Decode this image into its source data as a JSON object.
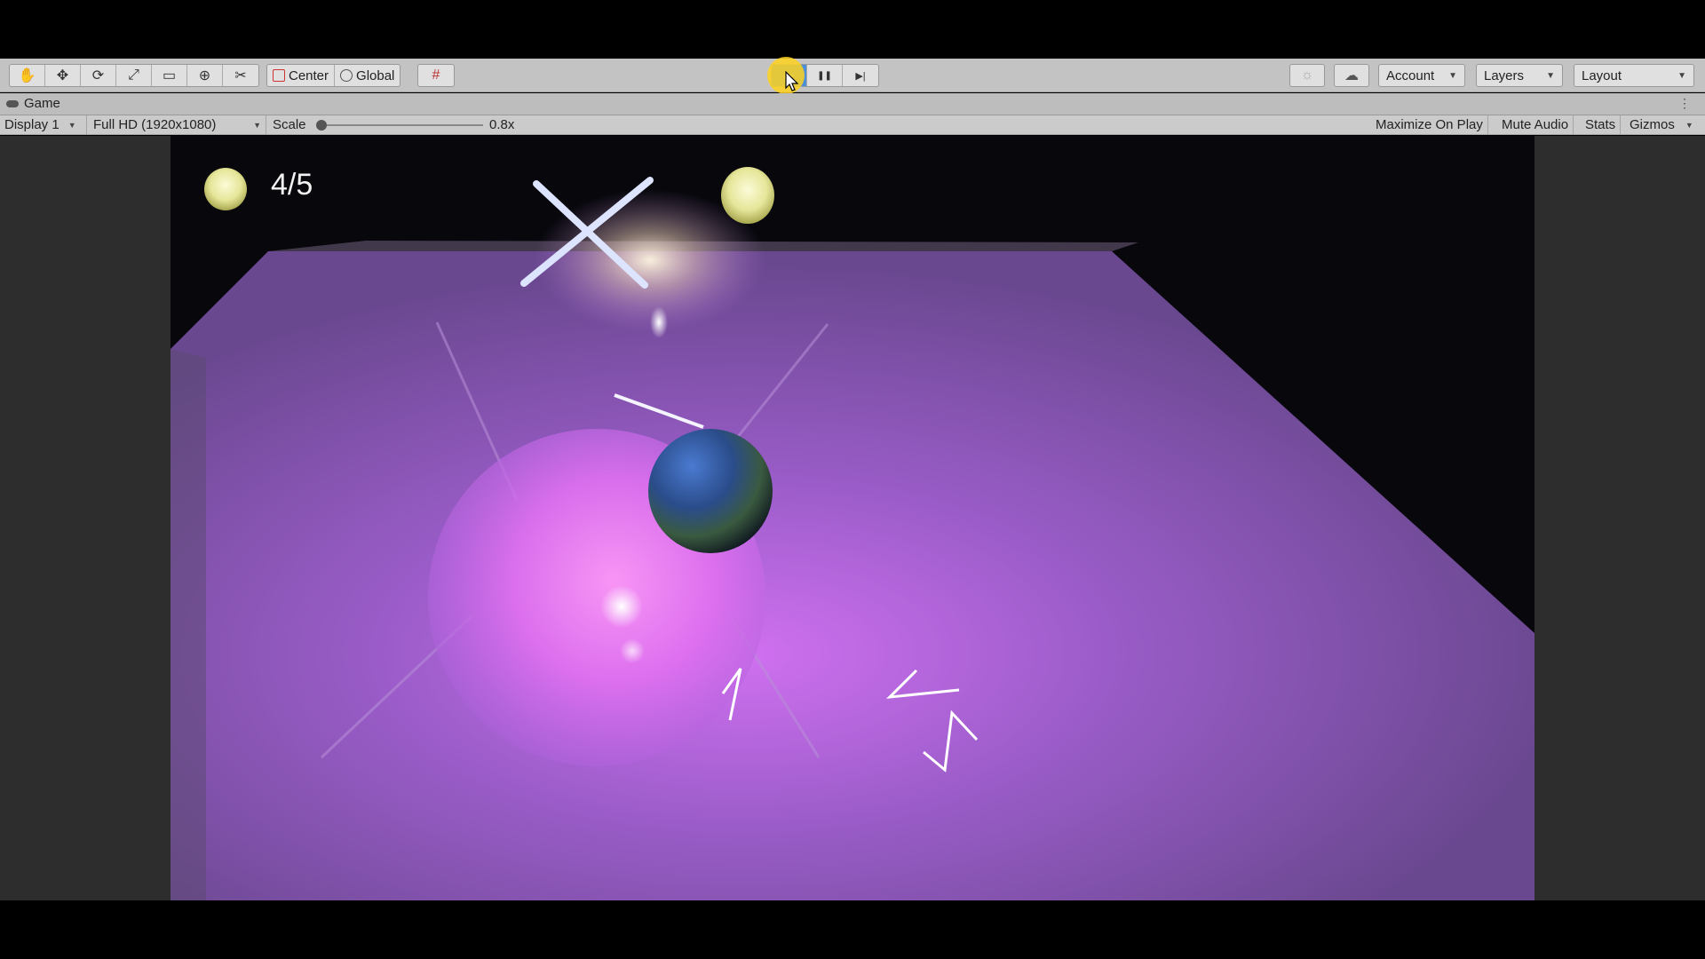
{
  "toolbar": {
    "tools": [
      {
        "name": "hand-tool",
        "icon": "hand-icon",
        "glyph": "✋"
      },
      {
        "name": "move-tool",
        "icon": "move-icon",
        "glyph": "✥"
      },
      {
        "name": "rotate-tool",
        "icon": "rotate-icon",
        "glyph": "⟳"
      },
      {
        "name": "scale-tool",
        "icon": "scale-icon",
        "glyph": "⤢"
      },
      {
        "name": "rect-tool",
        "icon": "rect-icon",
        "glyph": "▭"
      },
      {
        "name": "transform-tool",
        "icon": "transform-icon",
        "glyph": "⊕"
      },
      {
        "name": "custom-tool",
        "icon": "tools-icon",
        "glyph": "✂"
      }
    ],
    "pivot_mode": "Center",
    "pivot_rotation": "Global",
    "grid_snap_glyph": "#",
    "play": {
      "play_glyph": "▶",
      "pause_glyph": "❚❚",
      "step_glyph": "▶|"
    },
    "cloud_glyph": "☁",
    "collab_glyph": "☼",
    "account_label": "Account",
    "layers_label": "Layers",
    "layout_label": "Layout"
  },
  "tab": {
    "title": "Game",
    "menu_glyph": "⋮"
  },
  "gamebar": {
    "display": "Display 1",
    "resolution": "Full HD (1920x1080)",
    "scale_label": "Scale",
    "scale_value": "0.8x",
    "maximize": "Maximize On Play",
    "mute": "Mute Audio",
    "stats": "Stats",
    "gizmos": "Gizmos"
  },
  "game": {
    "collected": "4/5"
  },
  "colors": {
    "floor": "#7a4fa8",
    "glow": "#ff6ef5",
    "coin": "#e8e89a",
    "play_active": "#4a90d9",
    "cursor_highlight": "#ffd21e"
  }
}
